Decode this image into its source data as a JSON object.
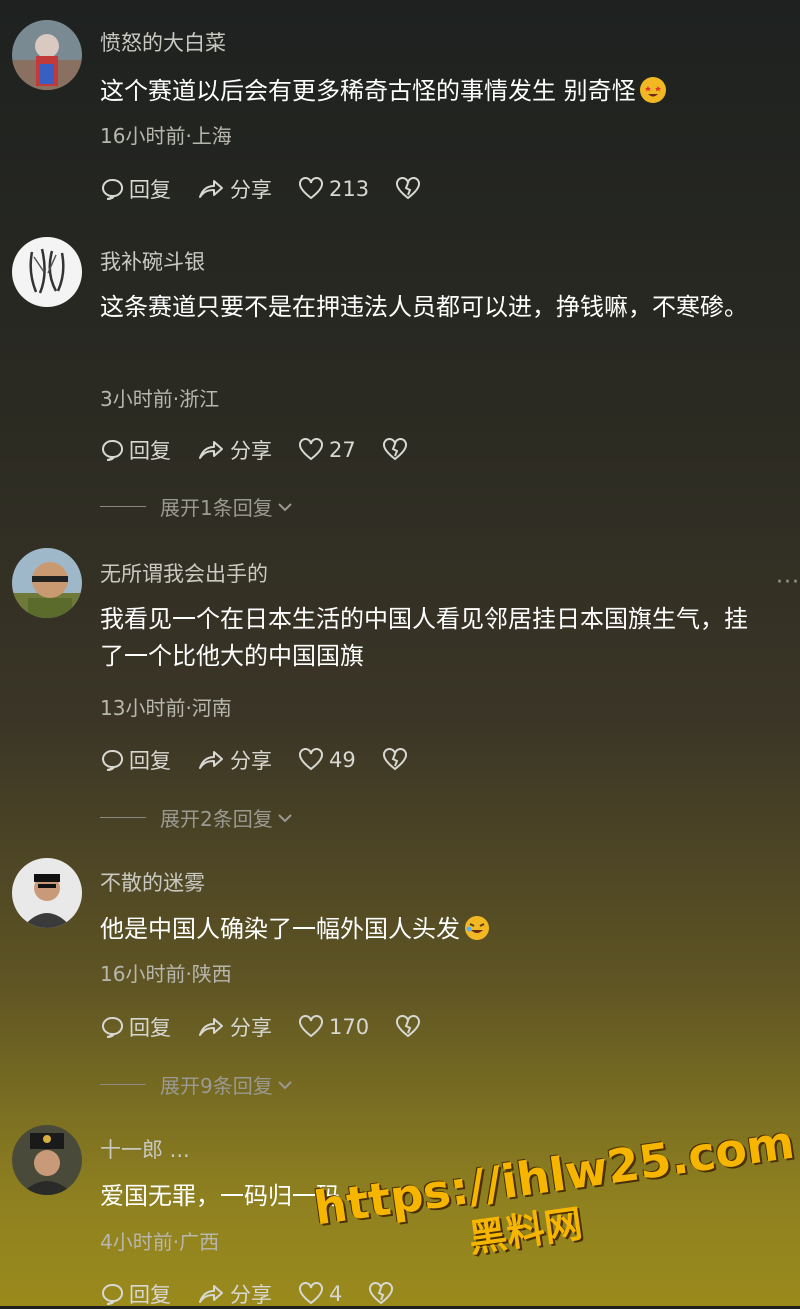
{
  "comments": [
    {
      "username": "愤怒的大白菜",
      "text": "这个赛道以后会有更多稀奇古怪的事情发生 别奇怪",
      "meta": "16小时前·上海",
      "reply_label": "回复",
      "share_label": "分享",
      "likes": "213",
      "emoji": "star-struck-emoji"
    },
    {
      "username": "我补碗斗银",
      "text": "这条赛道只要不是在押违法人员都可以进，挣钱嘛，不寒碜。",
      "meta": "3小时前·浙江",
      "reply_label": "回复",
      "share_label": "分享",
      "likes": "27",
      "expand": "展开1条回复"
    },
    {
      "username": "无所谓我会出手的",
      "text": "我看见一个在日本生活的中国人看见邻居挂日本国旗生气，挂了一个比他大的中国国旗",
      "meta": "13小时前·河南",
      "reply_label": "回复",
      "share_label": "分享",
      "likes": "49",
      "expand": "展开2条回复"
    },
    {
      "username": "不散的迷雾",
      "text": "他是中国人确染了一幅外国人头发",
      "meta": "16小时前·陕西",
      "reply_label": "回复",
      "share_label": "分享",
      "likes": "170",
      "expand": "展开9条回复",
      "emoji": "rolling-laughing-emoji"
    },
    {
      "username": "十一郎 ...",
      "text": "爱国无罪，一码归一码",
      "meta": "4小时前·广西",
      "reply_label": "回复",
      "share_label": "分享",
      "likes": "4"
    }
  ],
  "more_menu": "···",
  "watermark": {
    "url": "https://ihlw25.com",
    "name": "黑料网"
  },
  "colors": {
    "watermark": "#f6b600",
    "text": "#ffffff",
    "meta": "#b7b7ae"
  }
}
